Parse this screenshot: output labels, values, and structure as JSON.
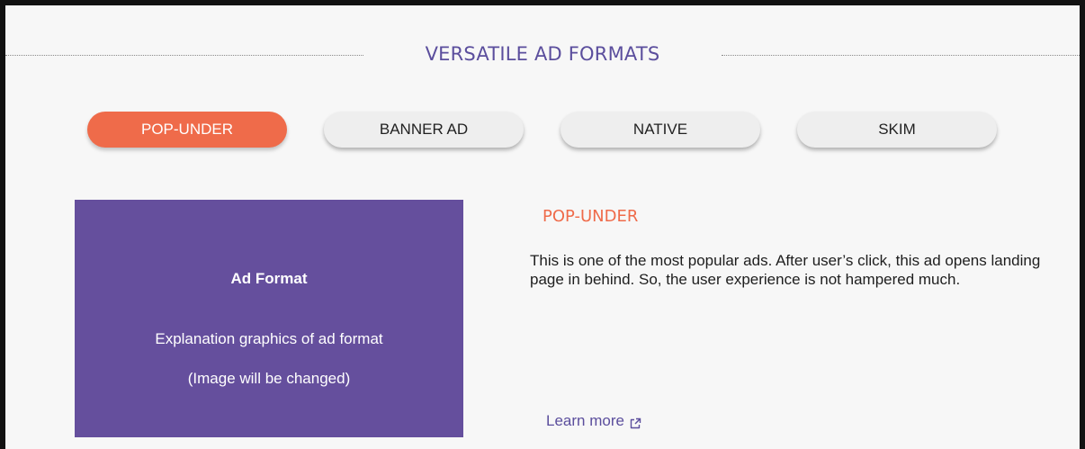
{
  "section": {
    "title": "VERSATILE AD FORMATS"
  },
  "tabs": [
    {
      "label": "POP-UNDER",
      "active": true
    },
    {
      "label": "BANNER AD",
      "active": false
    },
    {
      "label": "NATIVE",
      "active": false
    },
    {
      "label": "SKIM",
      "active": false
    }
  ],
  "image_placeholder": {
    "title": "Ad Format",
    "line1": "Explanation graphics of ad format",
    "line2": "(Image will be changed)"
  },
  "detail": {
    "title": "POP-UNDER",
    "description": "This is one of the most popular ads. After user’s click, this ad opens landing page in behind.  So, the user experience is not hampered much.",
    "learn_more": "Learn more",
    "learn_more_icon": "external-link-icon"
  },
  "colors": {
    "accent": "#ef6b4a",
    "brand_purple": "#5b4e9d",
    "image_bg": "#654f9d",
    "tab_bg": "#eeeeee",
    "page_bg": "#f7f7f7"
  }
}
